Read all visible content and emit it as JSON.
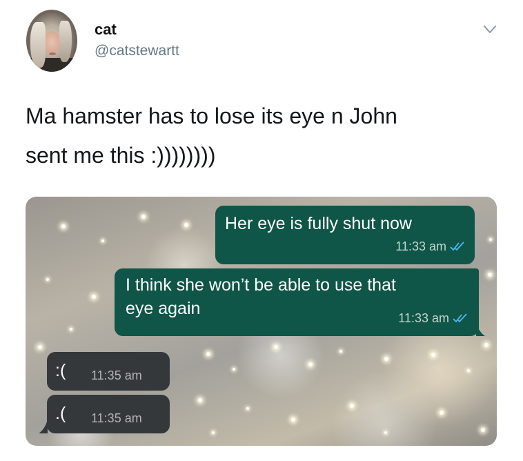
{
  "tweet": {
    "display_name": "cat",
    "handle": "@catstewartt",
    "text_line1": "Ma hamster has to lose its eye n John",
    "text_line2": "sent me this :))))))))"
  },
  "header_icons": {
    "menu": "chevron-down-icon"
  },
  "chat": {
    "messages": [
      {
        "direction": "outgoing",
        "text": "Her eye is fully shut now",
        "time": "11:33 am",
        "status": "read"
      },
      {
        "direction": "outgoing",
        "text_line1": "I think she won’t be able to use that",
        "text_line2": "eye again",
        "time": "11:33 am",
        "status": "read"
      },
      {
        "direction": "incoming",
        "text": ":(",
        "time": "11:35 am"
      },
      {
        "direction": "incoming",
        "text": ".(",
        "time": "11:35 am"
      }
    ]
  },
  "colors": {
    "outgoing_bubble": "#0f5548",
    "incoming_bubble": "#35383b",
    "read_ticks": "#4fb8f0",
    "handle_gray": "#657786"
  }
}
